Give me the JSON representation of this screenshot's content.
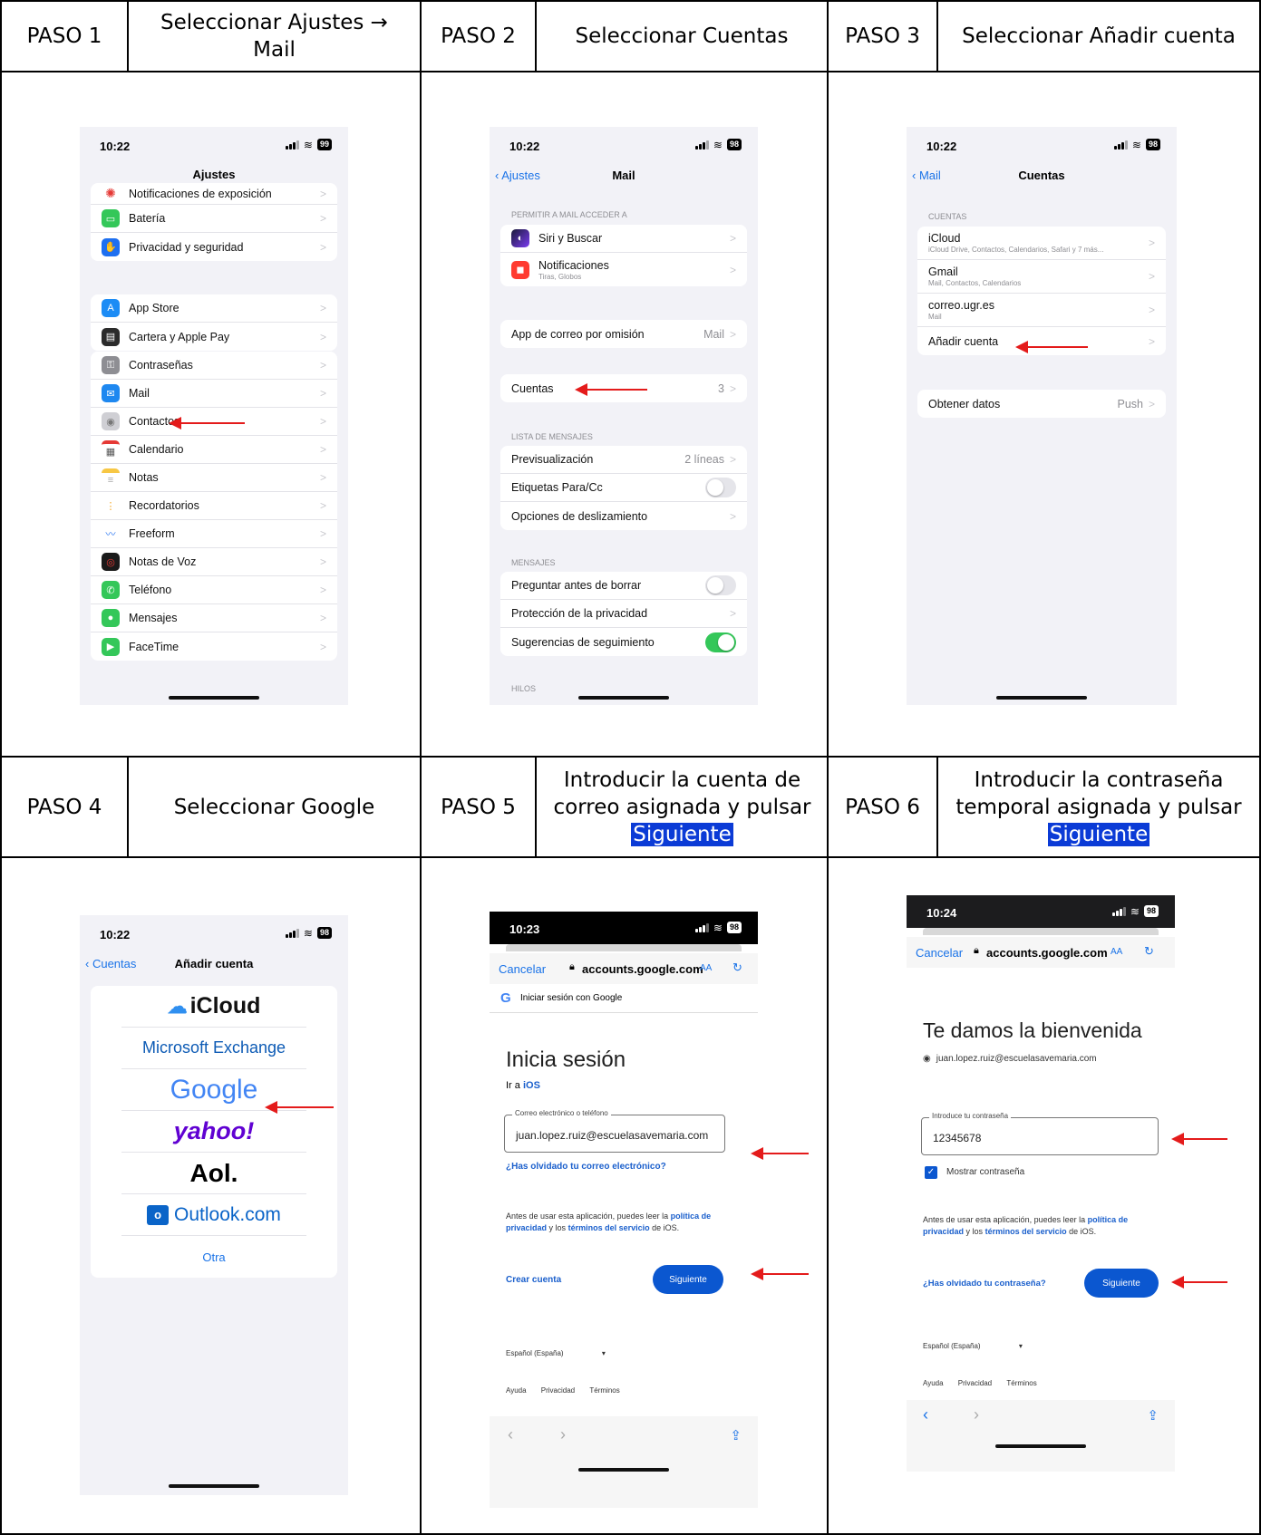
{
  "steps": [
    {
      "label": "PASO 1",
      "title": "Seleccionar Ajustes → Mail"
    },
    {
      "label": "PASO 2",
      "title": "Seleccionar Cuentas"
    },
    {
      "label": "PASO 3",
      "title": "Seleccionar Añadir cuenta"
    },
    {
      "label": "PASO 4",
      "title": "Seleccionar Google"
    },
    {
      "label": "PASO 5",
      "title_pre": "Introducir la cuenta de correo asignada y pulsar",
      "title_highlight": "Siguiente"
    },
    {
      "label": "PASO 6",
      "title_pre": "Introducir la contraseña temporal asignada y pulsar",
      "title_highlight": "Siguiente"
    }
  ],
  "phone1": {
    "time": "10:22",
    "battery": "99",
    "title": "Ajustes",
    "group1": [
      "Notificaciones de exposición",
      "Batería",
      "Privacidad y seguridad"
    ],
    "group2": [
      "App Store",
      "Cartera y Apple Pay"
    ],
    "group3": [
      "Contraseñas",
      "Mail",
      "Contactos",
      "Calendario",
      "Notas",
      "Recordatorios",
      "Freeform",
      "Notas de Voz",
      "Teléfono",
      "Mensajes",
      "FaceTime"
    ]
  },
  "phone2": {
    "time": "10:22",
    "battery": "98",
    "back": "Ajustes",
    "title": "Mail",
    "section1": "PERMITIR A MAIL ACCEDER A",
    "siri": "Siri y Buscar",
    "notif": "Notificaciones",
    "notif_sub": "Tiras, Globos",
    "default_app": "App de correo por omisión",
    "default_app_val": "Mail",
    "accounts": "Cuentas",
    "accounts_val": "3",
    "section2": "LISTA DE MENSAJES",
    "preview": "Previsualización",
    "preview_val": "2 líneas",
    "tags": "Etiquetas Para/Cc",
    "swipe": "Opciones de deslizamiento",
    "section3": "MENSAJES",
    "ask_delete": "Preguntar antes de borrar",
    "privacy": "Protección de la privacidad",
    "followup": "Sugerencias de seguimiento",
    "section4": "HILOS"
  },
  "phone3": {
    "time": "10:22",
    "battery": "98",
    "back": "Mail",
    "title": "Cuentas",
    "section": "CUENTAS",
    "accounts": [
      {
        "name": "iCloud",
        "sub": "iCloud Drive, Contactos, Calendarios, Safari y 7 más..."
      },
      {
        "name": "Gmail",
        "sub": "Mail, Contactos, Calendarios"
      },
      {
        "name": "correo.ugr.es",
        "sub": "Mail"
      }
    ],
    "add": "Añadir cuenta",
    "fetch": "Obtener datos",
    "fetch_val": "Push"
  },
  "phone4": {
    "time": "10:22",
    "battery": "98",
    "back": "Cuentas",
    "title": "Añadir cuenta",
    "providers": {
      "icloud": "iCloud",
      "exchange": "Microsoft Exchange",
      "google": "Google",
      "yahoo": "yahoo!",
      "aol": "Aol.",
      "outlook": "Outlook.com",
      "other": "Otra"
    }
  },
  "phone5": {
    "time": "10:23",
    "battery": "98",
    "cancel": "Cancelar",
    "url": "accounts.google.com",
    "aa": "AA",
    "signin_header": "Iniciar sesión con Google",
    "heading": "Inicia sesión",
    "goto_pre": "Ir a",
    "goto_link": "iOS",
    "field_label": "Correo electrónico o teléfono",
    "field_value": "juan.lopez.ruiz@escuelasavemaria.com",
    "forgot": "¿Has olvidado tu correo electrónico?",
    "legal_1": "Antes de usar esta aplicación, puedes leer la",
    "legal_privacy": "política de privacidad",
    "legal_and": "y los",
    "legal_terms": "términos del servicio",
    "legal_end": "de iOS.",
    "create": "Crear cuenta",
    "next": "Siguiente",
    "lang": "Español (España)",
    "footer": [
      "Ayuda",
      "Privacidad",
      "Términos"
    ]
  },
  "phone6": {
    "time": "10:24",
    "battery": "98",
    "cancel": "Cancelar",
    "url": "accounts.google.com",
    "aa": "AA",
    "heading": "Te damos la bienvenida",
    "email": "juan.lopez.ruiz@escuelasavemaria.com",
    "field_label": "Introduce tu contraseña",
    "field_value": "12345678",
    "show": "Mostrar contraseña",
    "legal_1": "Antes de usar esta aplicación, puedes leer la",
    "legal_privacy": "política de privacidad",
    "legal_and": "y los",
    "legal_terms": "términos del servicio",
    "legal_end": "de iOS.",
    "forgot": "¿Has olvidado tu contraseña?",
    "next": "Siguiente",
    "lang": "Español (España)",
    "footer": [
      "Ayuda",
      "Privacidad",
      "Términos"
    ]
  },
  "colors": {
    "highlight": "#0b3bd6",
    "arrow": "#e41b1b",
    "ios_blue": "#1a73e8",
    "google_blue": "#0b57d0"
  }
}
